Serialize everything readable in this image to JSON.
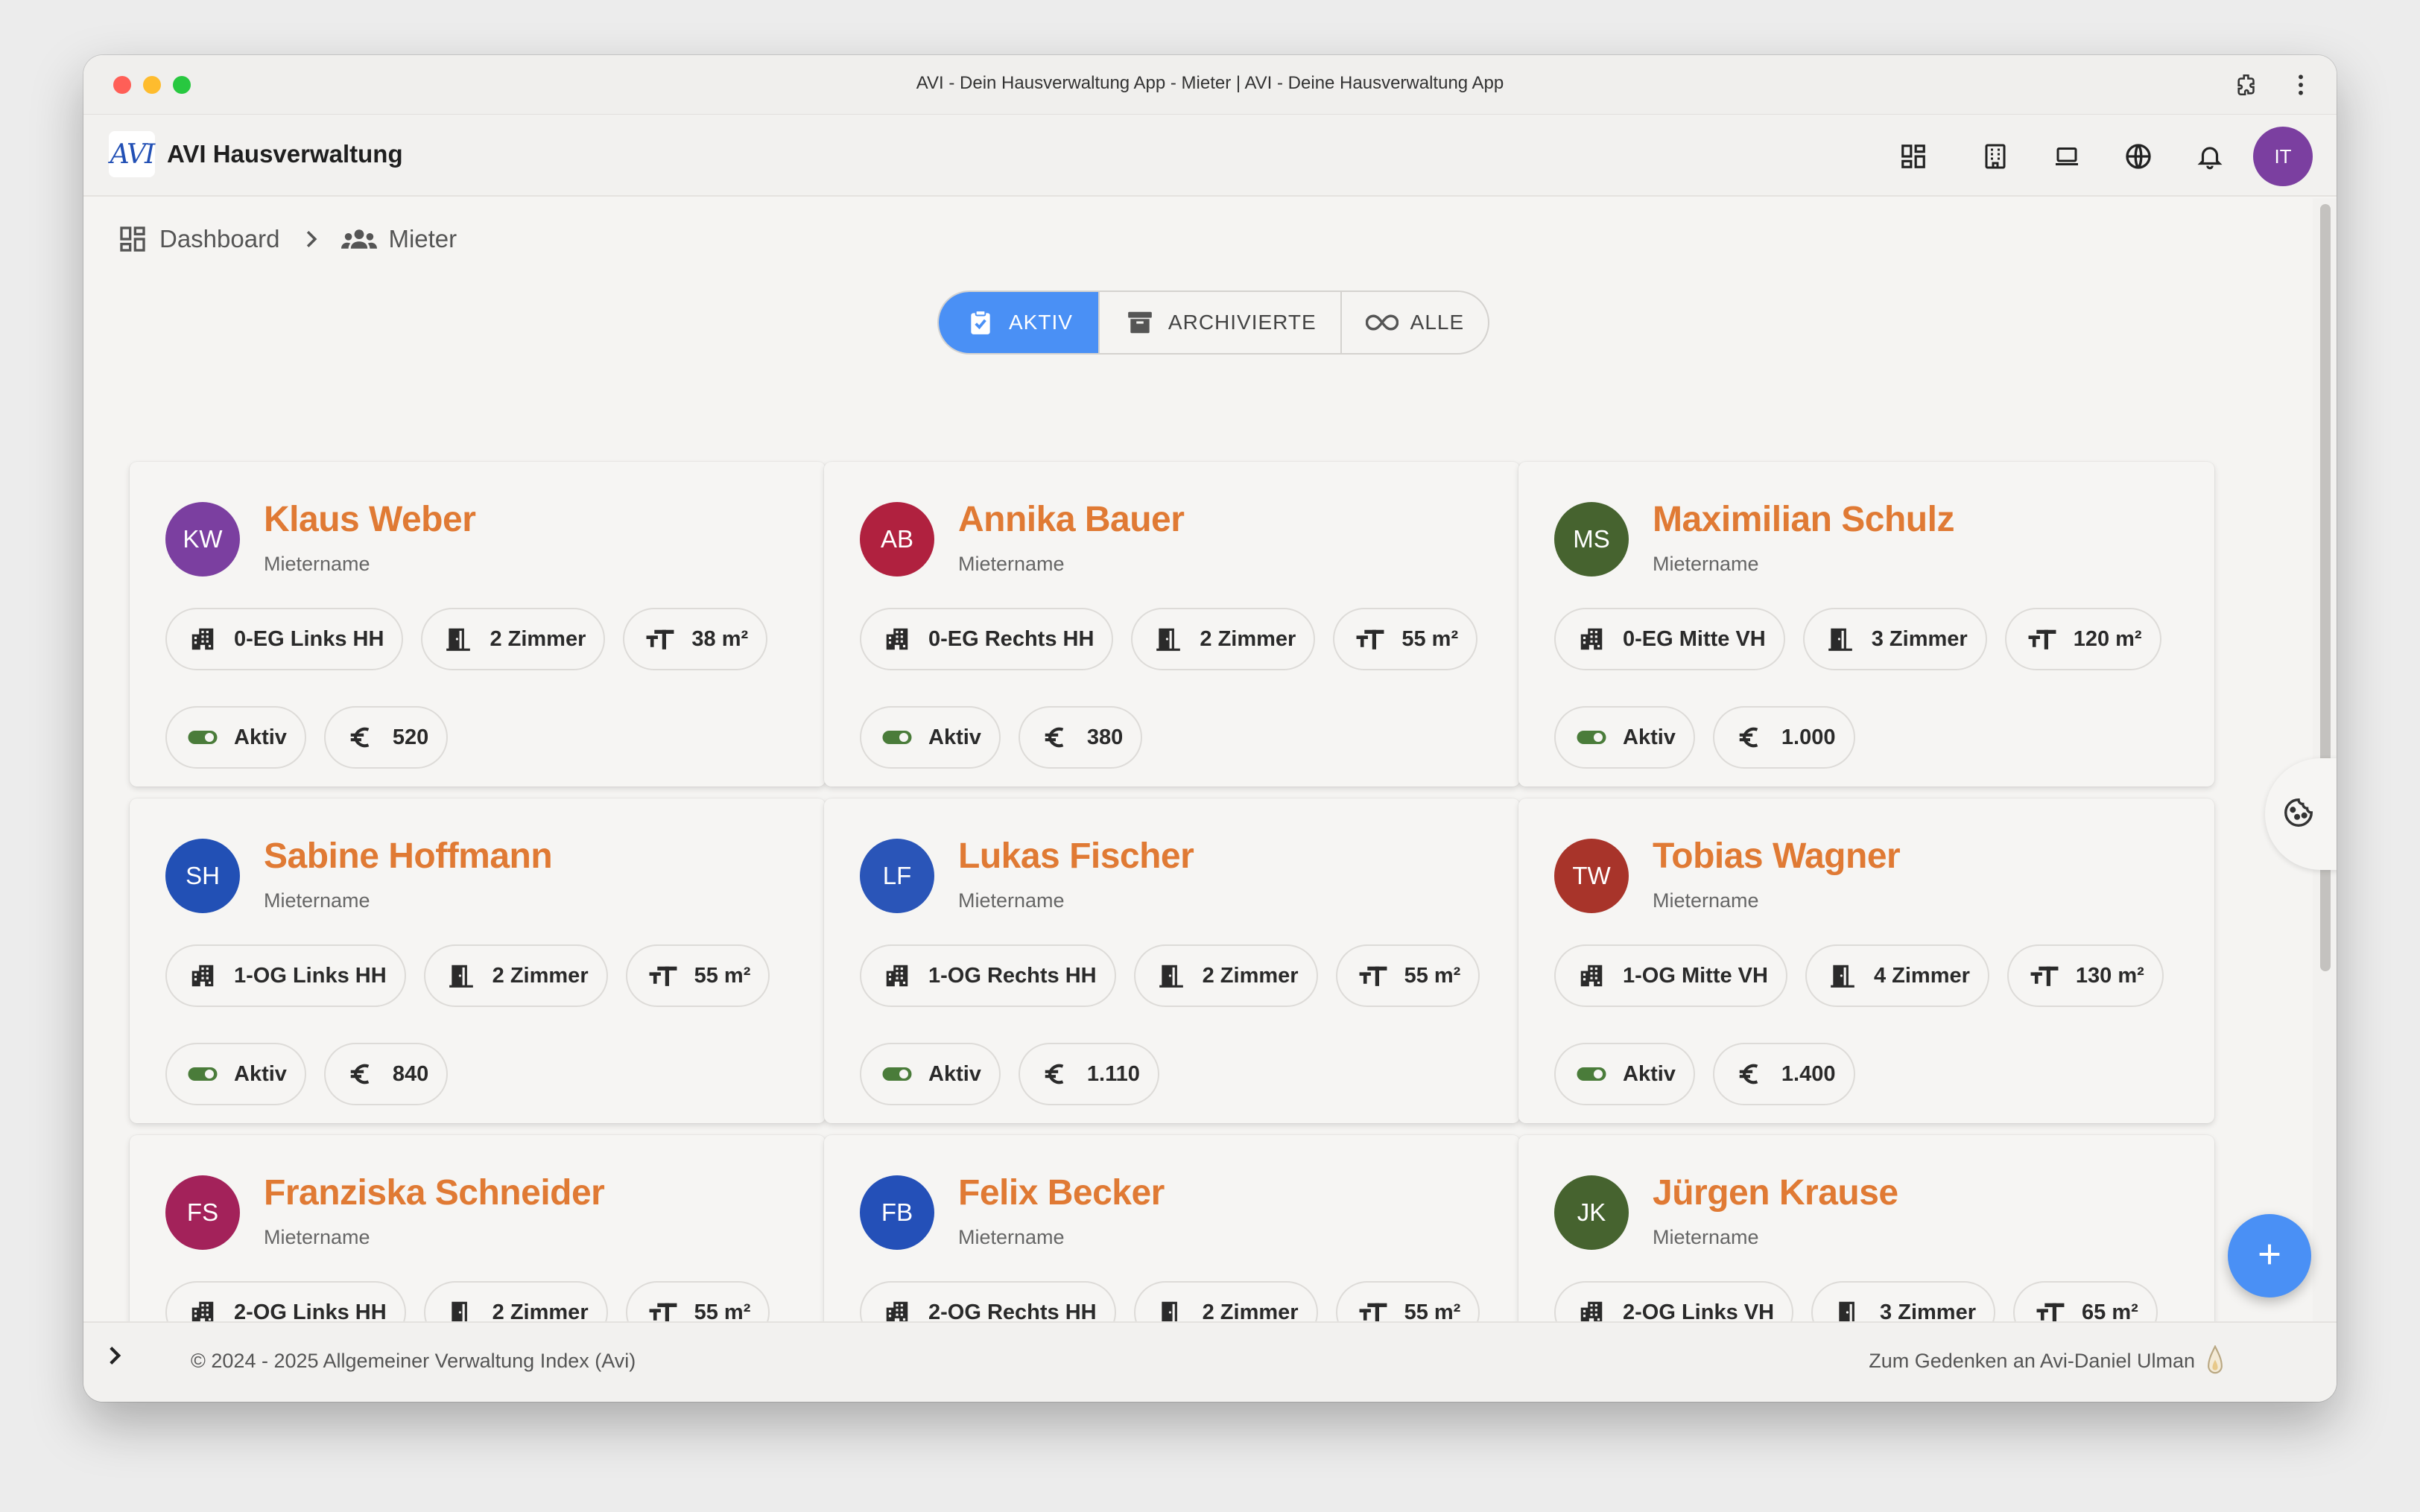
{
  "window": {
    "title": "AVI - Dein Hausverwaltung App - Mieter | AVI - Deine Hausverwaltung App"
  },
  "app": {
    "logo_text": "AVI",
    "title": "AVI Hausverwaltung",
    "user_initials": "IT"
  },
  "breadcrumb": {
    "home": "Dashboard",
    "current": "Mieter"
  },
  "filter": {
    "active": "AKTIV",
    "archived": "ARCHIVIERTE",
    "all": "ALLE"
  },
  "tenants": [
    {
      "initials": "KW",
      "name": "Klaus Weber",
      "subtitle": "Mietername",
      "unit": "0-EG Links HH",
      "rooms": "2 Zimmer",
      "area": "38 m²",
      "status": "Aktiv",
      "rent": "520",
      "color": "#7b3fa0"
    },
    {
      "initials": "AB",
      "name": "Annika Bauer",
      "subtitle": "Mietername",
      "unit": "0-EG Rechts HH",
      "rooms": "2 Zimmer",
      "area": "55 m²",
      "status": "Aktiv",
      "rent": "380",
      "color": "#b0213f"
    },
    {
      "initials": "MS",
      "name": "Maximilian Schulz",
      "subtitle": "Mietername",
      "unit": "0-EG Mitte VH",
      "rooms": "3 Zimmer",
      "area": "120 m²",
      "status": "Aktiv",
      "rent": "1.000",
      "color": "#46632f"
    },
    {
      "initials": "SH",
      "name": "Sabine Hoffmann",
      "subtitle": "Mietername",
      "unit": "1-OG Links HH",
      "rooms": "2 Zimmer",
      "area": "55 m²",
      "status": "Aktiv",
      "rent": "840",
      "color": "#2250b5"
    },
    {
      "initials": "LF",
      "name": "Lukas Fischer",
      "subtitle": "Mietername",
      "unit": "1-OG Rechts HH",
      "rooms": "2 Zimmer",
      "area": "55 m²",
      "status": "Aktiv",
      "rent": "1.110",
      "color": "#2a55b8"
    },
    {
      "initials": "TW",
      "name": "Tobias Wagner",
      "subtitle": "Mietername",
      "unit": "1-OG Mitte VH",
      "rooms": "4 Zimmer",
      "area": "130 m²",
      "status": "Aktiv",
      "rent": "1.400",
      "color": "#a8342a"
    },
    {
      "initials": "FS",
      "name": "Franziska Schneider",
      "subtitle": "Mietername",
      "unit": "2-OG Links HH",
      "rooms": "2 Zimmer",
      "area": "55 m²",
      "status": "Aktiv",
      "rent": "",
      "color": "#a3225a"
    },
    {
      "initials": "FB",
      "name": "Felix Becker",
      "subtitle": "Mietername",
      "unit": "2-OG Rechts HH",
      "rooms": "2 Zimmer",
      "area": "55 m²",
      "status": "Aktiv",
      "rent": "",
      "color": "#2450b8"
    },
    {
      "initials": "JK",
      "name": "Jürgen Krause",
      "subtitle": "Mietername",
      "unit": "2-OG Links VH",
      "rooms": "3 Zimmer",
      "area": "65 m²",
      "status": "Aktiv",
      "rent": "",
      "color": "#46632f"
    }
  ],
  "footer": {
    "copyright": "© 2024 - 2025 Allgemeiner Verwaltung Index (Avi)",
    "memorial": "Zum Gedenken an Avi-Daniel Ulman"
  },
  "colors": {
    "accent": "#4a90f5",
    "name": "#e07a34",
    "status_on": "#4a7c3a"
  }
}
